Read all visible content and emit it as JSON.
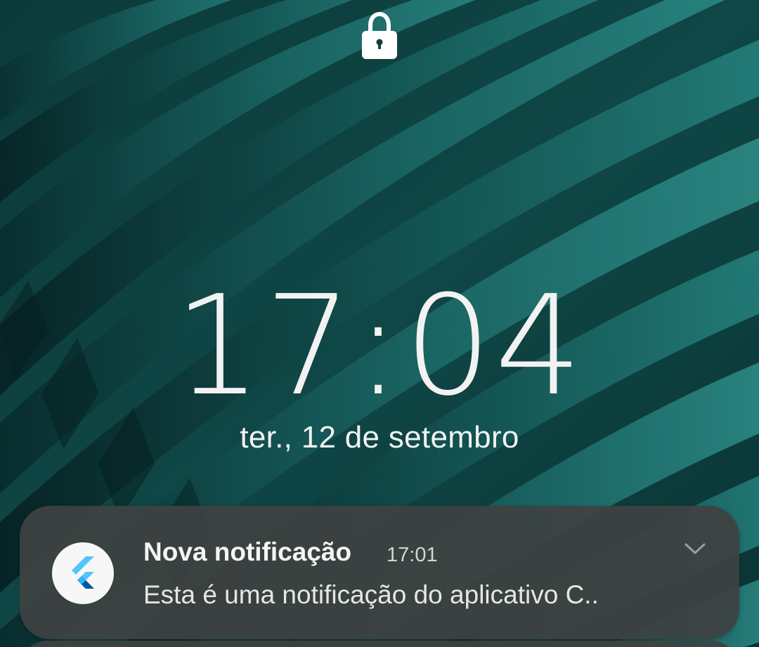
{
  "lockscreen": {
    "time": "17:04",
    "date": "ter., 12 de setembro",
    "lock_icon": "lock-icon"
  },
  "notification": {
    "app_icon": "flutter-logo-icon",
    "title": "Nova notificação",
    "time": "17:01",
    "body": "Esta é uma notificação do aplicativo C..",
    "expand_icon": "chevron-down-icon"
  },
  "colors": {
    "wallpaper_dark": "#08292a",
    "wallpaper_teal": "#1f6d6b",
    "wallpaper_light": "#2f8a86",
    "notification_bg": "#3e4242",
    "text_primary": "#f2f2f2",
    "flutter_light_blue": "#54c5f8",
    "flutter_dark_blue": "#01579b"
  }
}
